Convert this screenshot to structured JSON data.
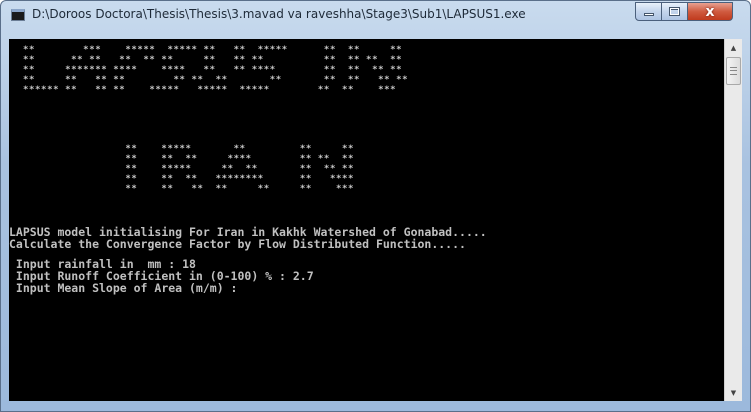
{
  "window": {
    "title": "D:\\Doroos Doctora\\Thesis\\Thesis\\3.mavad va raveshha\\Stage3\\Sub1\\LAPSUS1.exe",
    "icon": "console-app-icon",
    "buttons": {
      "minimize_icon": "minimize-icon",
      "maximize_icon": "maximize-icon",
      "close_icon": "close-icon",
      "close_glyph": "x"
    }
  },
  "console": {
    "banner_lapsus": "**        ***    *****  ***** **   **  *****      **  **     **\n**      ** **   **  ** **     **   ** **          **  ** **  **\n**     ******* ****    ****   **   ** ****        **  **  ** **\n**     **   ** **        ** **  **       **       **  **   ** **\n****** **   ** **    *****   *****  *****        **  **    ***",
    "banner_iran": "                 **    *****       **         **     **\n                 **    **  **     ****        ** **  **\n                 **    *****     **  **       **  ** **\n                 **    **  **   ********      **   ****\n                 **    **   **  **     **     **    ***",
    "lines": [
      "LAPSUS model initialising For Iran in Kakhk Watershed of Gonabad.....",
      "Calculate the Convergence Factor by Flow Distributed Function.....",
      " Input rainfall in  mm : 18",
      " Input Runoff Coefficient in (0-100) % : 2.7",
      " Input Mean Slope of Area (m/m) :"
    ]
  },
  "scrollbar": {
    "up_glyph": "▲",
    "down_glyph": "▼"
  },
  "colors": {
    "console_bg": "#000000",
    "console_text": "#c0c0c0",
    "close_button": "#c7422a"
  }
}
